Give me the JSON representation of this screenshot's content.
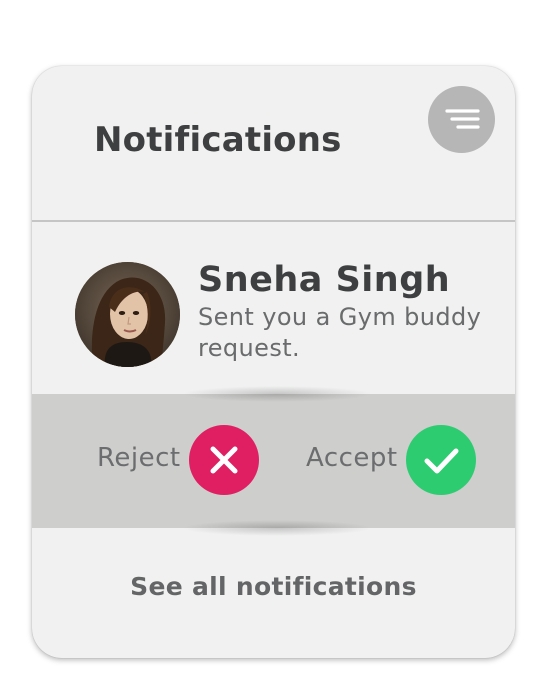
{
  "header": {
    "title": "Notifications",
    "menu_icon": "menu-lines-icon"
  },
  "notification": {
    "sender_name": "Sneha Singh",
    "message": "Sent you a Gym buddy request."
  },
  "actions": {
    "reject_label": "Reject",
    "reject_icon": "close-icon",
    "accept_label": "Accept",
    "accept_icon": "check-icon"
  },
  "footer": {
    "see_all_label": "See all notifications"
  },
  "colors": {
    "card_background": "#f0f1f0",
    "action_bar": "#cececd",
    "reject": "#e01f62",
    "accept": "#2ecc71",
    "menu_button": "#b5b6b5"
  }
}
